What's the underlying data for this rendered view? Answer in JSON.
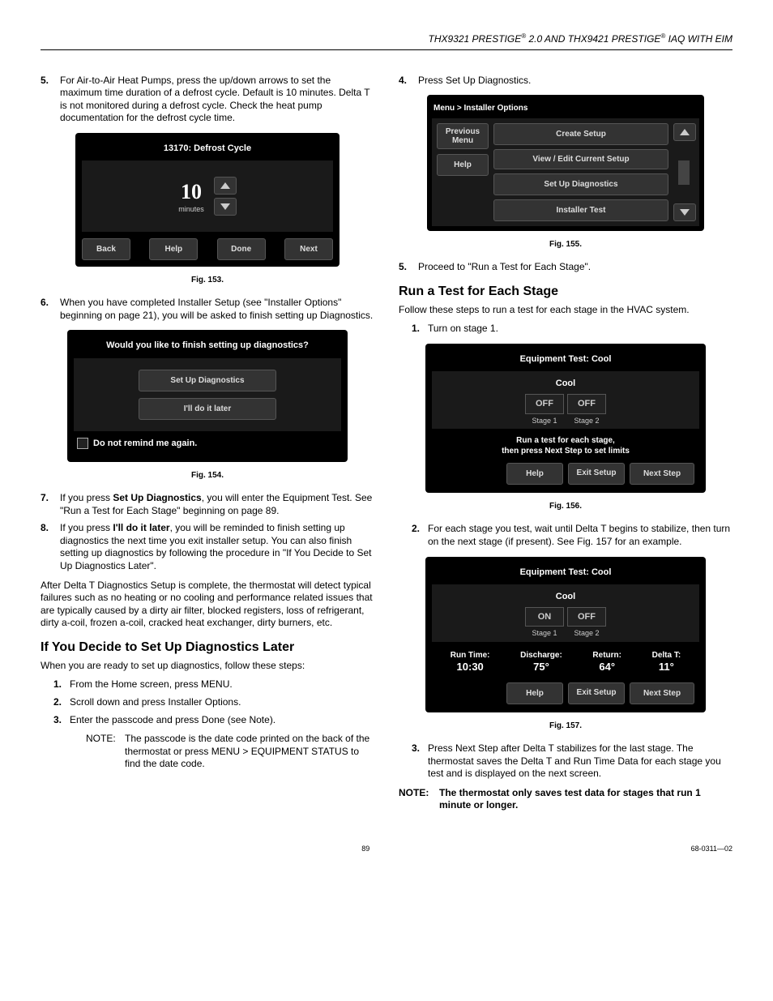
{
  "header": "THX9321 PRESTIGE® 2.0 AND THX9421 PRESTIGE® IAQ WITH EIM",
  "left": {
    "p5_num": "5.",
    "p5": "For Air-to-Air Heat Pumps, press the up/down arrows to set the maximum time duration of a defrost cycle. Default is 10 minutes. Delta T is not monitored during a defrost cycle. Check the heat pump documentation for the defrost cycle time.",
    "fig153_title": "13170: Defrost Cycle",
    "fig153_value": "10",
    "fig153_unit": "minutes",
    "fig153_back": "Back",
    "fig153_help": "Help",
    "fig153_done": "Done",
    "fig153_next": "Next",
    "fig153_cap": "Fig. 153.",
    "p6_num": "6.",
    "p6": "When you have completed Installer Setup (see \"Installer Options\" beginning on page 21), you will be asked to finish setting up Diagnostics.",
    "fig154_title": "Would you like to finish setting up diagnostics?",
    "fig154_b1": "Set Up Diagnostics",
    "fig154_b2": "I'll do it later",
    "fig154_chk": "Do not remind me again.",
    "fig154_cap": "Fig. 154.",
    "p7_num": "7.",
    "p7a": "If you press ",
    "p7b": "Set Up Diagnostics",
    "p7c": ", you will enter the Equipment Test. See \"Run a Test for Each Stage\" beginning on page 89.",
    "p8_num": "8.",
    "p8a": "If you press ",
    "p8b": "I'll do it later",
    "p8c": ", you will be reminded to finish setting up diagnostics the next time you exit installer setup. You can also finish setting up diagnostics by following the procedure in \"If You Decide to Set Up Diagnostics Later\".",
    "afterp": "After Delta T Diagnostics Setup is complete, the thermostat will detect typical failures such as no heating or no cooling and performance related issues that are typically caused by a dirty air filter, blocked registers, loss of refrigerant, dirty a-coil, frozen a-coil, cracked heat exchanger, dirty burners, etc.",
    "h_later": "If You Decide to Set Up Diagnostics Later",
    "later_intro": "When you are ready to set up diagnostics, follow these steps:",
    "l1_num": "1.",
    "l1": "From the Home screen, press MENU.",
    "l2_num": "2.",
    "l2": "Scroll down and press Installer Options.",
    "l3_num": "3.",
    "l3": "Enter the passcode and press Done (see Note).",
    "note_lbl": "NOTE:",
    "note_txt": "The passcode is the date code printed on the back of the thermostat or press MENU > EQUIPMENT STATUS to find the date code."
  },
  "right": {
    "p4_num": "4.",
    "p4": "Press Set Up Diagnostics.",
    "fig155_crumb": "Menu > Installer Options",
    "fig155_prev": "Previous Menu",
    "fig155_help": "Help",
    "fig155_b1": "Create Setup",
    "fig155_b2": "View / Edit Current Setup",
    "fig155_b3": "Set Up Diagnostics",
    "fig155_b4": "Installer Test",
    "fig155_cap": "Fig. 155.",
    "p5_num": "5.",
    "p5": "Proceed to \"Run a Test for Each Stage\".",
    "h_run": "Run a Test for Each Stage",
    "run_intro": "Follow these steps to run a test for each stage in the HVAC system.",
    "r1_num": "1.",
    "r1": "Turn on stage 1.",
    "fig156_title": "Equipment Test:  Cool",
    "fig156_sub": "Cool",
    "fig156_off": "OFF",
    "fig156_s1": "Stage 1",
    "fig156_s2": "Stage 2",
    "fig156_msg1": "Run a test for each stage,",
    "fig156_msg2": "then press Next Step to set limits",
    "fig156_help": "Help",
    "fig156_exit": "Exit Setup",
    "fig156_next": "Next Step",
    "fig156_cap": "Fig. 156.",
    "r2_num": "2.",
    "r2": "For each stage you test, wait until Delta T begins to stabilize, then turn on the next stage (if present). See Fig. 157 for an example.",
    "fig157_title": "Equipment Test:  Cool",
    "fig157_sub": "Cool",
    "fig157_on": "ON",
    "fig157_off": "OFF",
    "fig157_s1": "Stage 1",
    "fig157_s2": "Stage 2",
    "fig157_rt_lbl": "Run Time:",
    "fig157_rt_val": "10:30",
    "fig157_d_lbl": "Discharge:",
    "fig157_d_val": "75°",
    "fig157_ret_lbl": "Return:",
    "fig157_ret_val": "64°",
    "fig157_dt_lbl": "Delta T:",
    "fig157_dt_val": "11°",
    "fig157_help": "Help",
    "fig157_exit": "Exit Setup",
    "fig157_next": "Next Step",
    "fig157_cap": "Fig. 157.",
    "r3_num": "3.",
    "r3": "Press Next Step after Delta T stabilizes for the last stage. The thermostat saves the Delta T and Run Time Data for each stage you test and is displayed on the next screen.",
    "note2_lbl": "NOTE:",
    "note2_txt": "The thermostat only saves test data for stages that run 1 minute or longer."
  },
  "footer": {
    "page": "89",
    "doc": "68-0311—02"
  }
}
